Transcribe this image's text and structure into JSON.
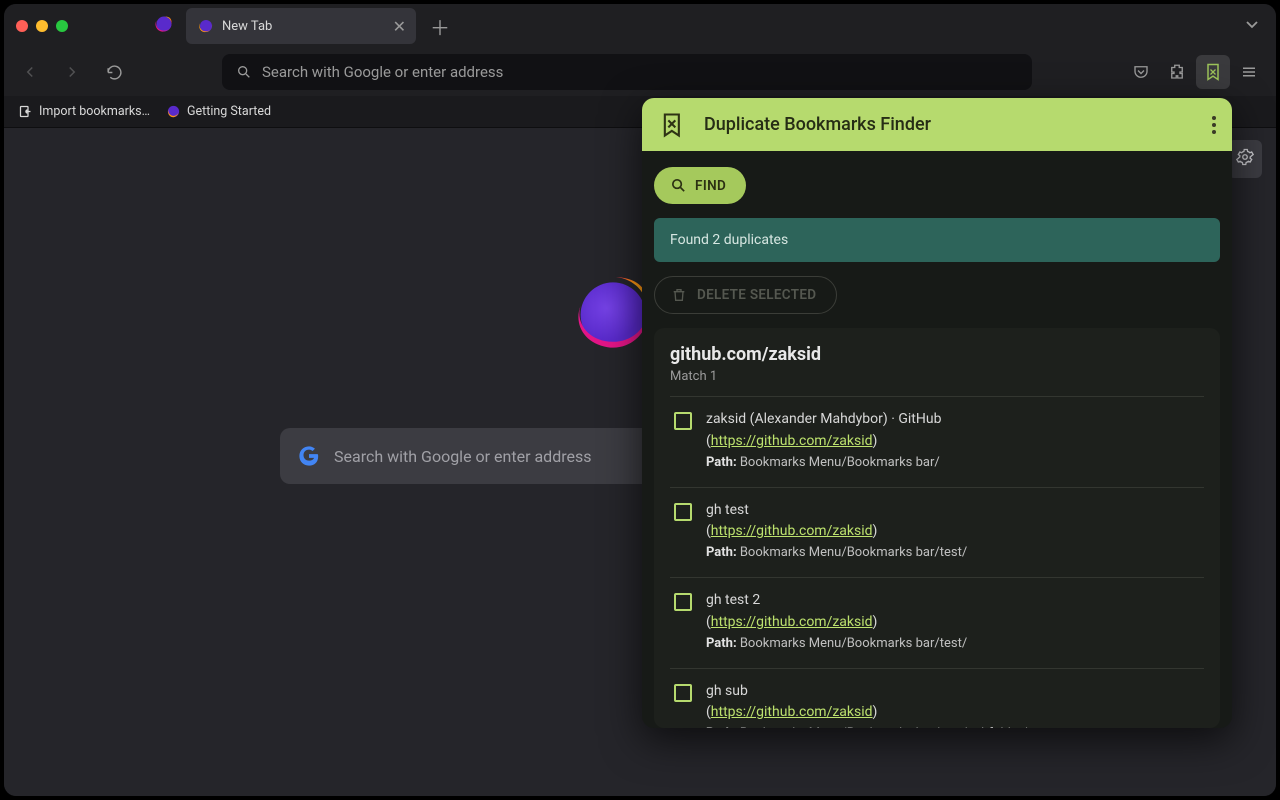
{
  "tabbar": {
    "tab_label": "New Tab"
  },
  "urlbar": {
    "placeholder": "Search with Google or enter address"
  },
  "bookmarks_toolbar": {
    "import": "Import bookmarks…",
    "getting_started": "Getting Started"
  },
  "newtab": {
    "search_placeholder": "Search with Google or enter address"
  },
  "popup": {
    "title": "Duplicate Bookmarks Finder",
    "find_label": "FIND",
    "notice": "Found 2 duplicates",
    "delete_label": "DELETE SELECTED",
    "group_title": "github.com/zaksid",
    "group_sub": "Match 1",
    "path_label": "Path:",
    "items": [
      {
        "title": "zaksid (Alexander Mahdybor) · GitHub",
        "url": "https://github.com/zaksid",
        "path": "Bookmarks Menu/Bookmarks bar/"
      },
      {
        "title": "gh test",
        "url": "https://github.com/zaksid",
        "path": "Bookmarks Menu/Bookmarks bar/test/"
      },
      {
        "title": "gh test 2",
        "url": "https://github.com/zaksid",
        "path": "Bookmarks Menu/Bookmarks bar/test/"
      },
      {
        "title": "gh sub",
        "url": "https://github.com/zaksid",
        "path": "Bookmarks Menu/Bookmarks bar/test/subfolder/"
      }
    ]
  }
}
